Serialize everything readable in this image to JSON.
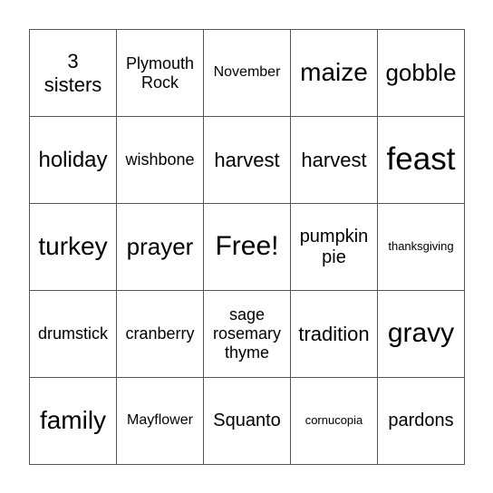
{
  "card": {
    "cells": [
      [
        "3\nsisters",
        "Plymouth\nRock",
        "November",
        "maize",
        "gobble"
      ],
      [
        "holiday",
        "wishbone",
        "harvest",
        "harvest",
        "feast"
      ],
      [
        "turkey",
        "prayer",
        "Free!",
        "pumpkin\npie",
        "thanksgiving"
      ],
      [
        "drumstick",
        "cranberry",
        "sage\nrosemary\nthyme",
        "tradition",
        "gravy"
      ],
      [
        "family",
        "Mayflower",
        "Squanto",
        "cornucopia",
        "pardons"
      ]
    ],
    "free_space": "Free!"
  }
}
